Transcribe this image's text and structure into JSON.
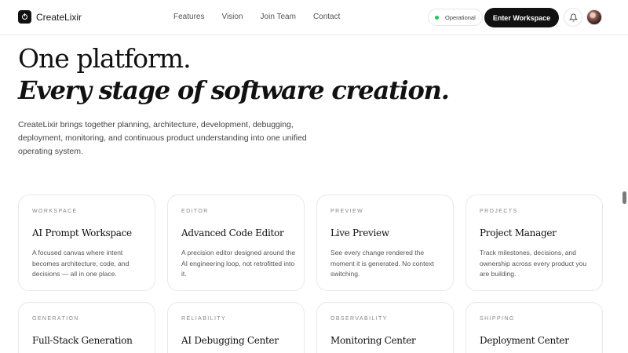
{
  "header": {
    "brand": "CreateLixir",
    "nav": [
      "Features",
      "Vision",
      "Join Team",
      "Contact"
    ],
    "status": {
      "label": "Operational",
      "color": "#22c55e"
    },
    "cta_label": "Enter Workspace"
  },
  "hero": {
    "title": "One platform.",
    "subtitle": "Every stage of software creation.",
    "description": "CreateLixir brings together planning, architecture, development, debugging, deployment, monitoring, and continuous product understanding into one unified operating system."
  },
  "cards": [
    {
      "category": "WORKSPACE",
      "title": "AI Prompt Workspace",
      "description": "A focused canvas where intent becomes architecture, code, and decisions — all in one place."
    },
    {
      "category": "EDITOR",
      "title": "Advanced Code Editor",
      "description": "A precision editor designed around the AI engineering loop, not retrofitted into it."
    },
    {
      "category": "PREVIEW",
      "title": "Live Preview",
      "description": "See every change rendered the moment it is generated. No context switching."
    },
    {
      "category": "PROJECTS",
      "title": "Project Manager",
      "description": "Track milestones, decisions, and ownership across every product you are building."
    },
    {
      "category": "GENERATION",
      "title": "Full-Stack Generation",
      "description": ""
    },
    {
      "category": "RELIABILITY",
      "title": "AI Debugging Center",
      "description": ""
    },
    {
      "category": "OBSERVABILITY",
      "title": "Monitoring Center",
      "description": ""
    },
    {
      "category": "SHIPPING",
      "title": "Deployment Center",
      "description": ""
    }
  ]
}
